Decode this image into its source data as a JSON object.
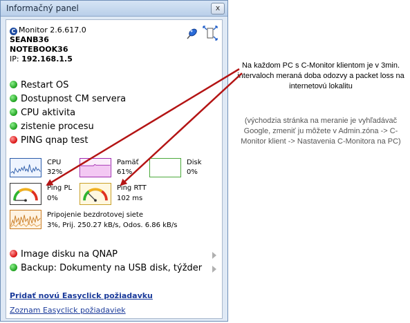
{
  "window": {
    "title": "Informačný panel",
    "close_label": "x"
  },
  "header": {
    "app_name": "Monitor 2.6.617.0",
    "user": "SEANB36",
    "computer": "NOTEBOOK36",
    "ip_label": "IP:",
    "ip_value": "192.168.1.5"
  },
  "checks": [
    {
      "label": "Restart OS",
      "status": "green"
    },
    {
      "label": "Dostupnost CM servera",
      "status": "green"
    },
    {
      "label": "CPU aktivita",
      "status": "green"
    },
    {
      "label": "zistenie procesu",
      "status": "green"
    },
    {
      "label": "PING  qnap test",
      "status": "red"
    }
  ],
  "metrics": {
    "cpu": {
      "label": "CPU",
      "value": "32%"
    },
    "memory": {
      "label": "Pamäť",
      "value": "61%"
    },
    "disk": {
      "label": "Disk",
      "value": "0%"
    },
    "ping_pl": {
      "label": "Ping PL",
      "value": "0%"
    },
    "ping_rtt": {
      "label": "Ping RTT",
      "value": "102 ms"
    },
    "wifi": {
      "label": "Pripojenie bezdrotovej siete",
      "value": "3%, Prij. 250.27 kB/s, Odos. 6.86 kB/s"
    }
  },
  "tasks": [
    {
      "label": "Image disku na QNAP",
      "status": "red"
    },
    {
      "label": "Backup: Dokumenty na USB disk, týžder",
      "status": "green"
    }
  ],
  "links": {
    "add_request": "Pridať novú Easyclick požiadavku",
    "list_requests": "Zoznam Easyclick požiadaviek"
  },
  "annotation": {
    "main": "Na každom PC s C-Monitor klientom je v 3min. intervaloch meraná doba odozvy a packet loss na internetovú lokalitu",
    "secondary": "(východzia stránka na meranie je vyhľadávač Google, zmeniť ju môžete v Admin.zóna -> C-Monitor klient -> Nastavenia C-Monitora na PC)"
  },
  "colors": {
    "status_green": "#1ea01e",
    "status_red": "#d81010",
    "link": "#1a3a9a",
    "arrow": "#b41414"
  }
}
